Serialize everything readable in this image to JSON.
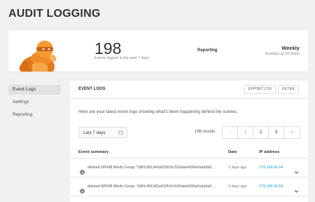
{
  "page": {
    "title": "AUDIT LOGGING"
  },
  "summary": {
    "count": "198",
    "count_label": "Events logged in the past 7 days",
    "reporting_label": "Reporting",
    "frequency": "Weekly",
    "schedule": "Sundays at 10:00am"
  },
  "sidebar": {
    "items": [
      {
        "label": "Event Logs",
        "active": true
      },
      {
        "label": "Settings",
        "active": false
      },
      {
        "label": "Reporting",
        "active": false
      }
    ]
  },
  "main": {
    "title": "EVENT LOGS",
    "export_label": "EXPORT CSV",
    "filter_label": "FILTER",
    "intro": "Here are your latest event logs showing what's been happening behind the scenes.",
    "range_select": {
      "value": "Last 7 days",
      "icon": "calendar-icon"
    },
    "results": "198 results",
    "pagination": {
      "prev": "‹",
      "pages": [
        "1",
        "2",
        "3"
      ],
      "next": "›",
      "current": "1"
    },
    "columns": [
      "Event summary",
      "Date",
      "IP address"
    ],
    "rows": [
      {
        "summary": "deleted WPHB Minify Group \"1881cf81342a532fc5c532dash436a0sda9a0...",
        "date": "3 days ago",
        "ip": "179.184.66.64"
      },
      {
        "summary": "deleted WPHB Minify Group \"1881cf81342a532fc5c532dash436a0sda9a0...",
        "date": "3 days ago",
        "ip": "179.184.66.64"
      }
    ]
  },
  "colors": {
    "accent": "#17a8e3",
    "background": "#f1f1f1",
    "mascot": "#f08c28"
  }
}
